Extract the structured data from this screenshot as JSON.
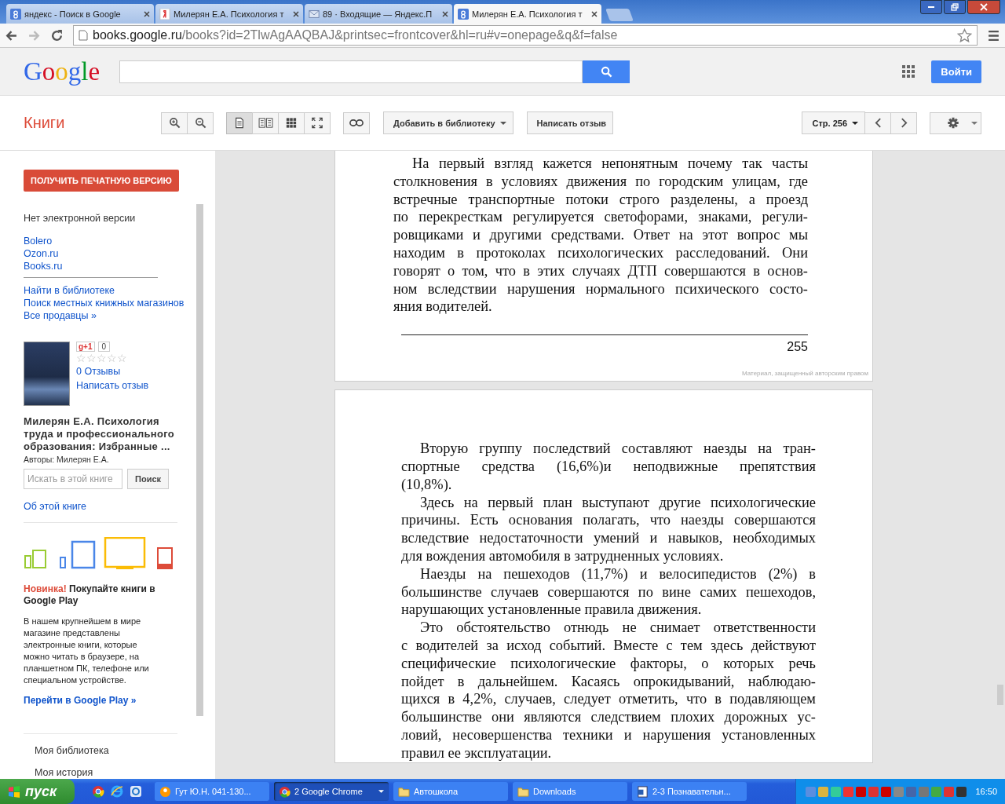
{
  "browser": {
    "tabs": [
      {
        "title": "яндекс - Поиск в Google",
        "kind": "google",
        "selected": false
      },
      {
        "title": "Милерян Е.А. Психология т",
        "kind": "yandex",
        "selected": false
      },
      {
        "title": "89 · Входящие — Яндекс.П",
        "kind": "mail",
        "selected": false
      },
      {
        "title": "Милерян Е.А. Психология т",
        "kind": "google",
        "selected": true
      }
    ],
    "address": {
      "host": "books.google.ru",
      "path": "/books?id=2TlwAgAAQBAJ&printsec=frontcover&hl=ru#v=onepage&q&f=false"
    }
  },
  "header": {
    "logo": "Google",
    "signin": "Войти"
  },
  "toolbar": {
    "title": "Книги",
    "view_modes": [
      {
        "selected": true
      },
      {
        "selected": false
      },
      {
        "selected": false
      },
      {
        "selected": false
      }
    ],
    "add_library": "Добавить в библиотеку",
    "write_review": "Написать отзыв",
    "page": "Стр. 256"
  },
  "sidebar": {
    "print_button": "ПОЛУЧИТЬ ПЕЧАТНУЮ ВЕРСИЮ",
    "no_ebook": "Нет электронной версии",
    "sellers": [
      "Bolero",
      "Ozon.ru",
      "Books.ru"
    ],
    "more_links": [
      "Найти в библиотеке",
      "Поиск местных книжных магазинов",
      "Все продавцы »"
    ],
    "plusone": "g+1",
    "plus_count": "0",
    "stars": 0,
    "reviews": "0 Отзывы",
    "write_review": "Написать отзыв",
    "book_title": "Милерян Е.А. Психология труда и профессионального образования: Избранные ...",
    "authors": "Авторы: Милерян Е.А.",
    "search": {
      "placeholder": "Искать в этой книге",
      "button": "Поиск"
    },
    "about": "Об этой книге",
    "promo": {
      "headline": "**Новинка!** Покупайте книги в Google Play",
      "text": "В нашем крупнейшем в мире магазине представлены электронные книги, которые можно читать в браузере, на планшетном ПК, телефоне или специальном устройстве.",
      "link": "Перейти в Google Play »"
    },
    "menu": [
      "Моя библиотека",
      "Моя история"
    ]
  },
  "pages": [
    {
      "paragraphs": [
        [
          "На первый взгляд кажется непонятным почему так часты",
          "столкновения в условиях движения по городским улицам, где",
          "встречные транспортные потоки строго разделены, а проезд",
          "по перекресткам регулируется светофорами, знаками, регули-",
          "ровщиками и другими средствами. Ответ на этот вопрос мы",
          "находим в протоколах психологических расследований. Они",
          "говорят о том, что в этих случаях ДТП совершаются в основ-",
          "ном вследствии нарушения нормального психического состо-",
          "яния водителей."
        ]
      ],
      "page_number": "255",
      "notice": "Материал, защищенный авторским правом"
    },
    {
      "paragraphs": [
        [
          "Вторую группу последствий составляют наезды на тран-",
          "спортные средства (16,6%)и неподвижные препятствия",
          "(10,8%)."
        ],
        [
          "Здесь на первый план выступают другие психологические",
          "причины. Есть основания полагать, что наезды совершаются",
          "вследствие недостаточности умений и навыков, необходимых",
          "для вождения автомобиля в затрудненных условиях."
        ],
        [
          "Наезды на пешеходов (11,7%) и велосипедистов (2%) в",
          "большинстве случаев совершаются по вине самих пешеходов,",
          "нарушающих установленные правила движения."
        ],
        [
          "Это обстоятельство отнюдь не снимает ответственности",
          "с водителей за исход событий. Вместе с тем здесь действуют",
          "специфические психологические факторы, о которых речь",
          "пойдет в дальнейшем. Касаясь опрокидываний, наблюдаю-",
          "щихся в 4,2%, случаев, следует отметить, что в подавляющем",
          "большинстве они являются следствием плохих дорожных ус-",
          "ловий, несовершенства техники и нарушения установленных",
          "правил ее эксплуатации."
        ]
      ]
    }
  ],
  "taskbar": {
    "start": "пуск",
    "tasks": [
      {
        "label": "Гут Ю.Н. 041-130...",
        "kind": "app",
        "selected": false
      },
      {
        "label": "2 Google Chrome",
        "kind": "chrome",
        "selected": true
      },
      {
        "label": "Автошкола",
        "kind": "folder",
        "selected": false
      },
      {
        "label": "Downloads",
        "kind": "folder",
        "selected": false
      },
      {
        "label": "2-3 Познавательн...",
        "kind": "document",
        "selected": false
      }
    ],
    "clock": "16:50"
  }
}
